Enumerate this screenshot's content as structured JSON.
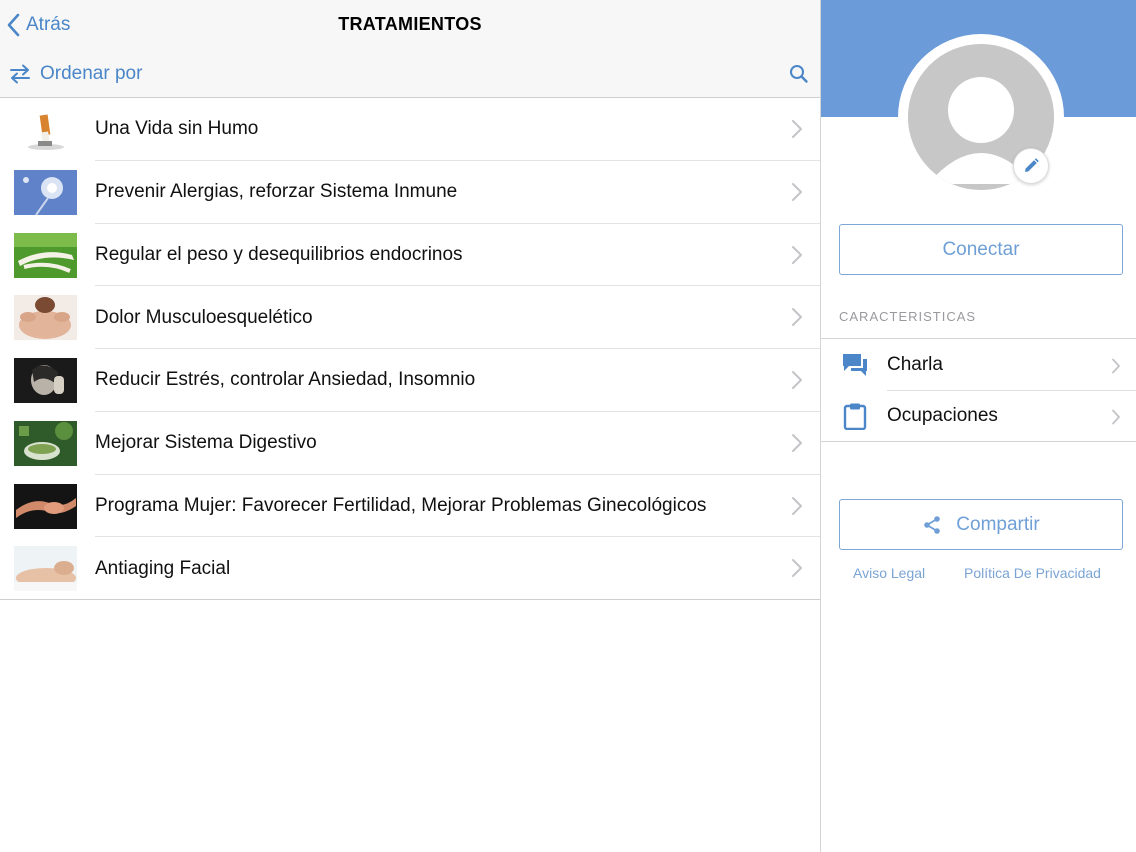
{
  "navbar": {
    "back_label": "Atrás",
    "title": "TRATAMIENTOS"
  },
  "toolbar": {
    "sort_label": "Ordenar por"
  },
  "treatments": [
    {
      "label": "Una Vida sin Humo"
    },
    {
      "label": "Prevenir Alergias, reforzar Sistema Inmune"
    },
    {
      "label": "Regular el peso y desequilibrios endocrinos"
    },
    {
      "label": "Dolor Musculoesquelético"
    },
    {
      "label": "Reducir Estrés, controlar Ansiedad, Insomnio"
    },
    {
      "label": "Mejorar Sistema Digestivo"
    },
    {
      "label": "Programa Mujer: Favorecer Fertilidad, Mejorar Problemas Ginecológicos"
    },
    {
      "label": "Antiaging Facial"
    }
  ],
  "profile": {
    "connect_label": "Conectar",
    "section_title": "CARACTERISTICAS",
    "features": [
      {
        "label": "Charla",
        "icon": "chat-bubbles-icon"
      },
      {
        "label": "Ocupaciones",
        "icon": "clipboard-icon"
      }
    ],
    "share_label": "Compartir",
    "legal_link": "Aviso Legal",
    "privacy_link": "Política De Privacidad"
  },
  "colors": {
    "accent": "#4a86c8",
    "banner": "#6b9bd9",
    "button_text": "#6f9fd6",
    "avatar": "#c7c7c7"
  }
}
